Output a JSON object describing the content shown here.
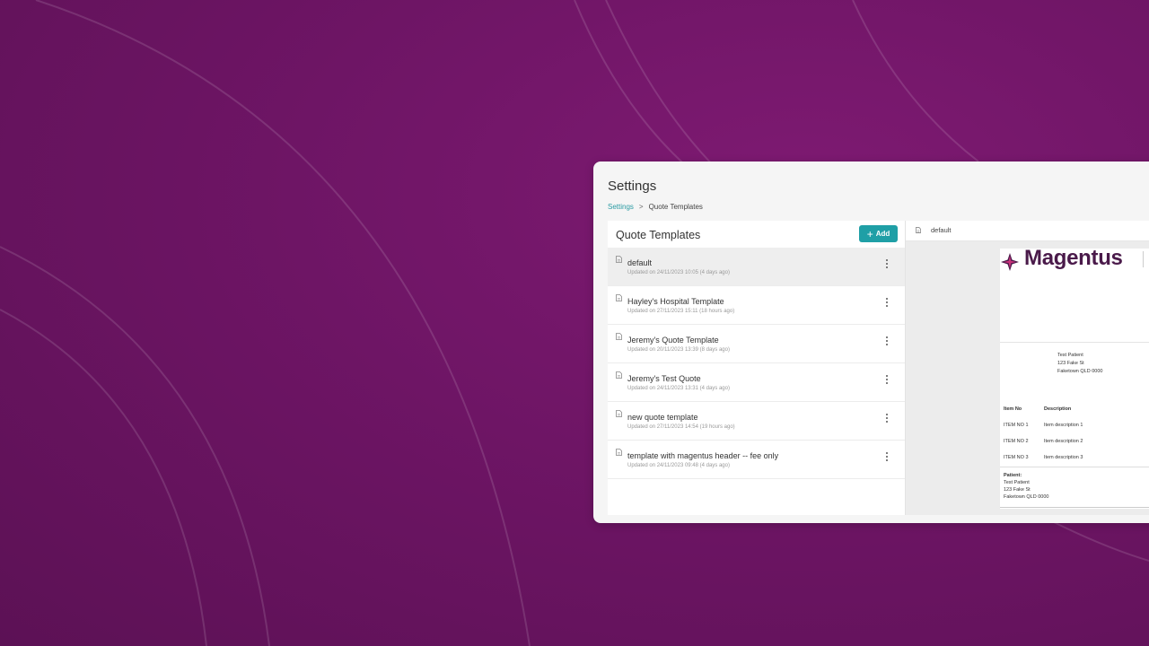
{
  "page": {
    "title": "Settings"
  },
  "breadcrumb": {
    "root": "Settings",
    "separator": ">",
    "current": "Quote Templates"
  },
  "list": {
    "title": "Quote Templates",
    "add_label": "Add",
    "items": [
      {
        "name": "default",
        "updated": "Updated on 24/11/2023 10:05 (4 days ago)"
      },
      {
        "name": "Hayley's Hospital Template",
        "updated": "Updated on 27/11/2023 15:11 (18 hours ago)"
      },
      {
        "name": "Jeremy's Quote Template",
        "updated": "Updated on 20/11/2023 13:39 (8 days ago)"
      },
      {
        "name": "Jeremy's Test Quote",
        "updated": "Updated on 24/11/2023 13:31 (4 days ago)"
      },
      {
        "name": "new quote template",
        "updated": "Updated on 27/11/2023 14:54 (19 hours ago)"
      },
      {
        "name": "template with magentus header -- fee only",
        "updated": "Updated on 24/11/2023 09:48 (4 days ago)"
      }
    ]
  },
  "preview": {
    "name": "default",
    "logo_text": "Magentus",
    "patient": {
      "name": "Test Patient",
      "street": "123 Fake St",
      "city": "Faketown QLD 0000"
    },
    "table": {
      "headers": {
        "item_no": "Item No",
        "description": "Description"
      },
      "rows": [
        {
          "no": "ITEM NO 1",
          "desc": "Item description 1"
        },
        {
          "no": "ITEM NO 2",
          "desc": "Item description 2"
        },
        {
          "no": "ITEM NO 3",
          "desc": "Item description 3"
        }
      ]
    },
    "footer": {
      "label": "Patient:",
      "name": "Test Patient",
      "street": "123 Fake St",
      "city": "Faketown QLD 0000"
    }
  },
  "colors": {
    "accent": "#1f9fa6",
    "background": "#6e1565",
    "brand": "#4a1a4a"
  }
}
